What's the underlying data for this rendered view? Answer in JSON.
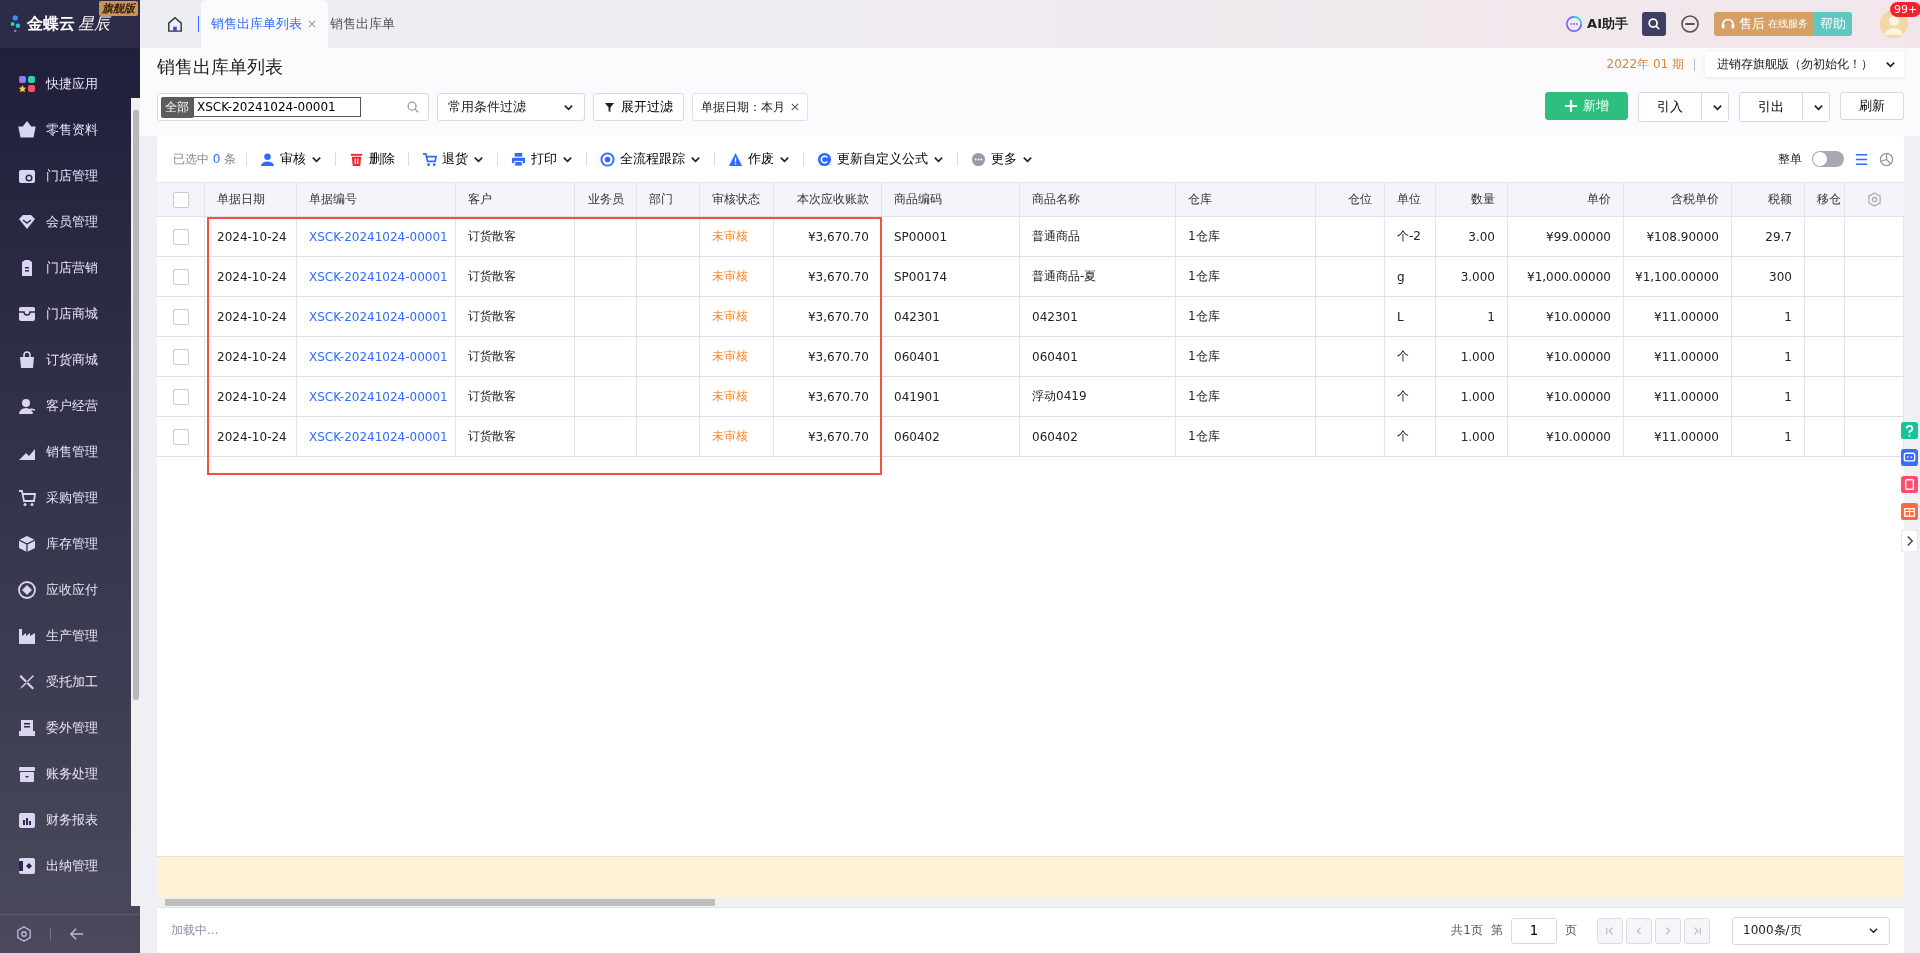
{
  "sidebar": {
    "logo": "金蝶云",
    "logo_italic": "星辰",
    "edition_badge": "旗舰版",
    "items": [
      {
        "label": "快捷应用"
      },
      {
        "label": "零售资料"
      },
      {
        "label": "门店管理"
      },
      {
        "label": "会员管理"
      },
      {
        "label": "门店营销"
      },
      {
        "label": "门店商城"
      },
      {
        "label": "订货商城"
      },
      {
        "label": "客户经营"
      },
      {
        "label": "销售管理"
      },
      {
        "label": "采购管理"
      },
      {
        "label": "库存管理"
      },
      {
        "label": "应收应付"
      },
      {
        "label": "生产管理"
      },
      {
        "label": "受托加工"
      },
      {
        "label": "委外管理"
      },
      {
        "label": "账务处理"
      },
      {
        "label": "财务报表"
      },
      {
        "label": "出纳管理"
      }
    ]
  },
  "tabs": [
    {
      "label": "销售出库单列表",
      "selected": true,
      "closable": true
    },
    {
      "label": "销售出库单",
      "selected": false,
      "closable": false
    }
  ],
  "top_tools": {
    "ai": "AI助手",
    "service": "售后",
    "service_sub": "在线服务",
    "help": "帮助",
    "avatar_badge": "99+"
  },
  "page": {
    "title": "销售出库单列表",
    "period": "2022年 01 期",
    "account": "进销存旗舰版（勿初始化！）"
  },
  "filter": {
    "scope": "全部",
    "search_value": "XSCK-20241024-00001",
    "preset": "常用条件过滤",
    "expand": "展开过滤",
    "chips": [
      {
        "label": "单据日期：本月"
      }
    ]
  },
  "actions": [
    {
      "label": "新增",
      "kind": "primary"
    },
    {
      "label": "引入",
      "kind": "split"
    },
    {
      "label": "引出",
      "kind": "split"
    },
    {
      "label": "刷新",
      "kind": "plain"
    }
  ],
  "toolbar": {
    "selected_prefix": "已选中",
    "selected_count": "0",
    "selected_suffix": "条",
    "buttons": [
      {
        "label": "审核",
        "has_menu": true
      },
      {
        "label": "删除",
        "has_menu": false
      },
      {
        "label": "退货",
        "has_menu": true
      },
      {
        "label": "打印",
        "has_menu": true
      },
      {
        "label": "全流程跟踪",
        "has_menu": true
      },
      {
        "label": "作废",
        "has_menu": true
      },
      {
        "label": "更新自定义公式",
        "has_menu": true
      },
      {
        "label": "更多",
        "has_menu": true
      }
    ],
    "whole_order_label": "整单",
    "whole_order_on": false,
    "list_view_selected": true
  },
  "table": {
    "select_all_checked": false,
    "columns": [
      {
        "label": "单据日期",
        "kind": "text"
      },
      {
        "label": "单据编号",
        "kind": "link"
      },
      {
        "label": "客户",
        "kind": "text"
      },
      {
        "label": "业务员",
        "kind": "right"
      },
      {
        "label": "部门",
        "kind": "text"
      },
      {
        "label": "审核状态",
        "kind": "status"
      },
      {
        "label": "本次应收账款",
        "kind": "number"
      },
      {
        "label": "商品编码",
        "kind": "text"
      },
      {
        "label": "商品名称",
        "kind": "text"
      },
      {
        "label": "仓库",
        "kind": "text"
      },
      {
        "label": "仓位",
        "kind": "right"
      },
      {
        "label": "单位",
        "kind": "text"
      },
      {
        "label": "数量",
        "kind": "number"
      },
      {
        "label": "单价",
        "kind": "number"
      },
      {
        "label": "含税单价",
        "kind": "number"
      },
      {
        "label": "税额",
        "kind": "number"
      },
      {
        "label": "移仓",
        "kind": "text"
      }
    ],
    "rows": [
      {
        "checked": false,
        "cells": [
          "2024-10-24",
          "XSCK-20241024-00001",
          "订货散客",
          null,
          null,
          "未审核",
          "¥3,670.70",
          "SP00001",
          "普通商品",
          "1仓库",
          null,
          "个-2",
          "3.00",
          "¥99.00000",
          "¥108.90000",
          "29.7",
          null
        ]
      },
      {
        "checked": false,
        "cells": [
          "2024-10-24",
          "XSCK-20241024-00001",
          "订货散客",
          null,
          null,
          "未审核",
          "¥3,670.70",
          "SP00174",
          "普通商品-夏",
          "1仓库",
          null,
          "g",
          "3.000",
          "¥1,000.00000",
          "¥1,100.00000",
          "300",
          null
        ]
      },
      {
        "checked": false,
        "cells": [
          "2024-10-24",
          "XSCK-20241024-00001",
          "订货散客",
          null,
          null,
          "未审核",
          "¥3,670.70",
          "042301",
          "042301",
          "1仓库",
          null,
          "L",
          "1",
          "¥10.00000",
          "¥11.00000",
          "1",
          null
        ]
      },
      {
        "checked": false,
        "cells": [
          "2024-10-24",
          "XSCK-20241024-00001",
          "订货散客",
          null,
          null,
          "未审核",
          "¥3,670.70",
          "060401",
          "060401",
          "1仓库",
          null,
          "个",
          "1.000",
          "¥10.00000",
          "¥11.00000",
          "1",
          null
        ]
      },
      {
        "checked": false,
        "cells": [
          "2024-10-24",
          "XSCK-20241024-00001",
          "订货散客",
          null,
          null,
          "未审核",
          "¥3,670.70",
          "041901",
          "浮动0419",
          "1仓库",
          null,
          "个",
          "1.000",
          "¥10.00000",
          "¥11.00000",
          "1",
          null
        ]
      },
      {
        "checked": false,
        "cells": [
          "2024-10-24",
          "XSCK-20241024-00001",
          "订货散客",
          null,
          null,
          "未审核",
          "¥3,670.70",
          "060402",
          "060402",
          "1仓库",
          null,
          "个",
          "1.000",
          "¥10.00000",
          "¥11.00000",
          "1",
          null
        ]
      }
    ],
    "highlight_rows": true
  },
  "footer": {
    "status": "加载中...",
    "total_pages": "共1页",
    "page_prefix": "第",
    "page": "1",
    "page_suffix": "页",
    "page_size": "1000条/页"
  }
}
